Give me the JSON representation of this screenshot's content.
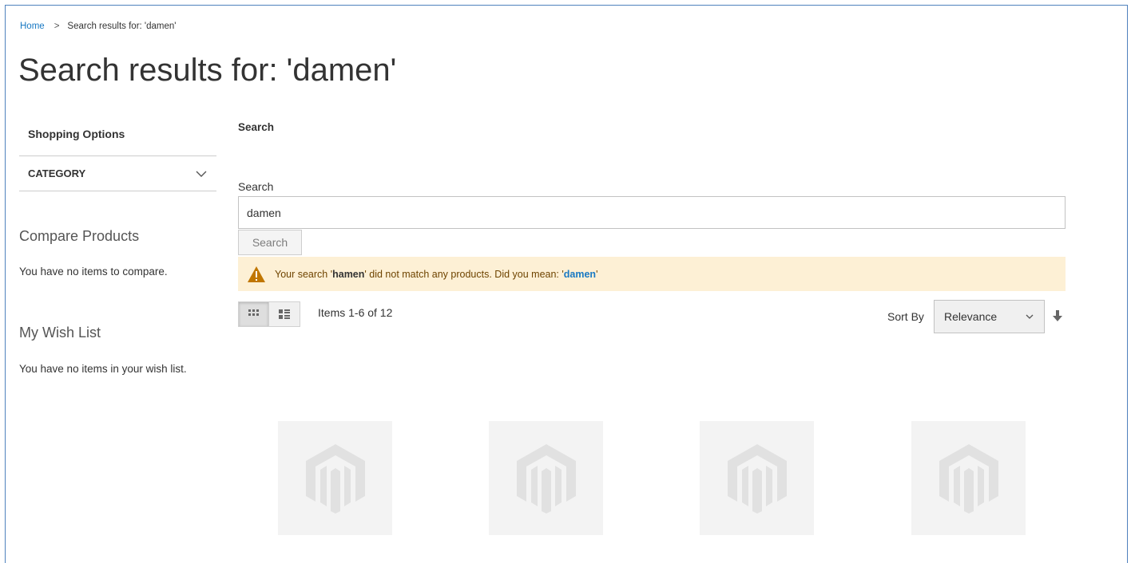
{
  "breadcrumb": {
    "home": "Home",
    "separator": ">",
    "current": "Search results for: 'damen'"
  },
  "page_title": "Search results for: 'damen'",
  "sidebar": {
    "shopping_options": "Shopping Options",
    "filter_category": "CATEGORY",
    "compare_title": "Compare Products",
    "compare_empty": "You have no items to compare.",
    "wishlist_title": "My Wish List",
    "wishlist_empty": "You have no items in your wish list."
  },
  "search": {
    "heading": "Search",
    "label": "Search",
    "value": "damen",
    "button": "Search"
  },
  "notice": {
    "prefix": "Your search '",
    "query": "hamen",
    "middle": "' did not match any products. Did you mean:  '",
    "suggestion": "damen",
    "suffix": "'"
  },
  "toolbar": {
    "items_count": "Items 1-6 of 12",
    "sort_label": "Sort By",
    "sort_value": "Relevance"
  },
  "colors": {
    "link": "#1979c3",
    "notice_bg": "#fdf0d5",
    "warning": "#c07600",
    "frame": "#4f81bd"
  },
  "icons": [
    "chevron-down-icon",
    "warning-icon",
    "grid-view-icon",
    "list-view-icon",
    "arrow-down-icon",
    "magento-placeholder-icon"
  ]
}
